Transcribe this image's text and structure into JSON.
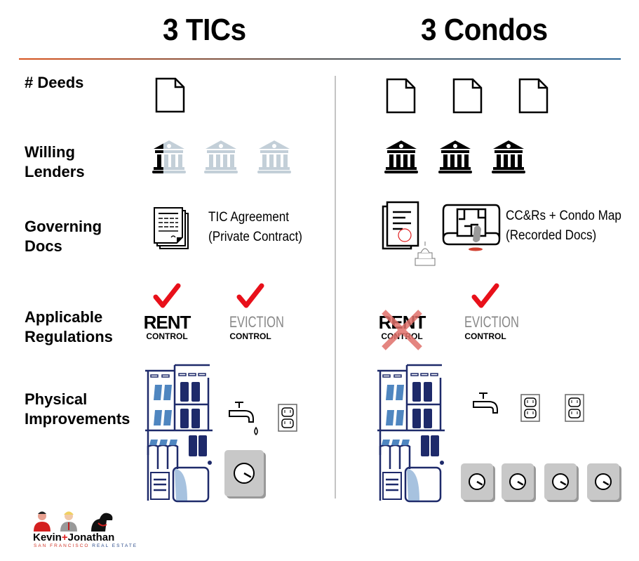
{
  "columns": {
    "left_title": "3 TICs",
    "right_title": "3 Condos"
  },
  "rows": {
    "deeds": {
      "label": "# Deeds",
      "tic_count": 1,
      "condo_count": 3
    },
    "lenders": {
      "label_line1": "Willing",
      "label_line2": "Lenders",
      "tic_willing_fraction": 0.33,
      "tic_total": 3,
      "condo_willing": 3,
      "condo_total": 3
    },
    "governing": {
      "label_line1": "Governing",
      "label_line2": "Docs",
      "tic_line1": "TIC Agreement",
      "tic_line2": "(Private Contract)",
      "condo_line1": "CC&Rs + Condo Map",
      "condo_line2": "(Recorded Docs)"
    },
    "regulations": {
      "label_line1": "Applicable",
      "label_line2": "Regulations",
      "rent_main": "RENT",
      "eviction_main": "EVICTION",
      "control": "CONTROL",
      "tic_rent_control": true,
      "tic_eviction_control": true,
      "condo_rent_control": false,
      "condo_eviction_control": true
    },
    "physical": {
      "label_line1": "Physical",
      "label_line2": "Improvements",
      "tic_water_heaters": 1,
      "tic_outlets": 1,
      "tic_meters": 1,
      "condo_water_heaters": 1,
      "condo_outlets": 2,
      "condo_meters": 4
    }
  },
  "logo": {
    "name_a": "Kevin",
    "plus": "+",
    "name_b": "Jonathan",
    "tag_a": "SAN FRANCISCO",
    "tag_b": "REAL ESTATE"
  },
  "colors": {
    "check": "#e8101a",
    "cross": "#e0706a",
    "lender_inactive": "#c3cfd8",
    "building_dark": "#1e2a6a",
    "building_light": "#4f86c0",
    "meter_gray": "#c8c8c8"
  }
}
